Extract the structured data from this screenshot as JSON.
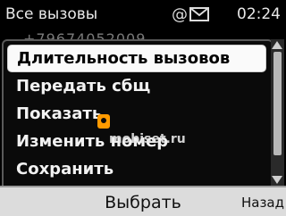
{
  "status": {
    "title": "Все вызовы",
    "at_symbol": "@",
    "time": "02:24",
    "icons": [
      "at-icon",
      "envelope-icon"
    ]
  },
  "behind": {
    "ghost_text": "+79674052009"
  },
  "menu": {
    "items": [
      {
        "label": "Длительность вызовов",
        "selected": true
      },
      {
        "label": "Передать сбщ"
      },
      {
        "label": "Показать"
      },
      {
        "label": "Изменить номер"
      },
      {
        "label": "Сохранить"
      }
    ]
  },
  "watermark": {
    "text": "mobiset.ru"
  },
  "softkeys": {
    "select": "Выбрать",
    "back": "Назад"
  }
}
